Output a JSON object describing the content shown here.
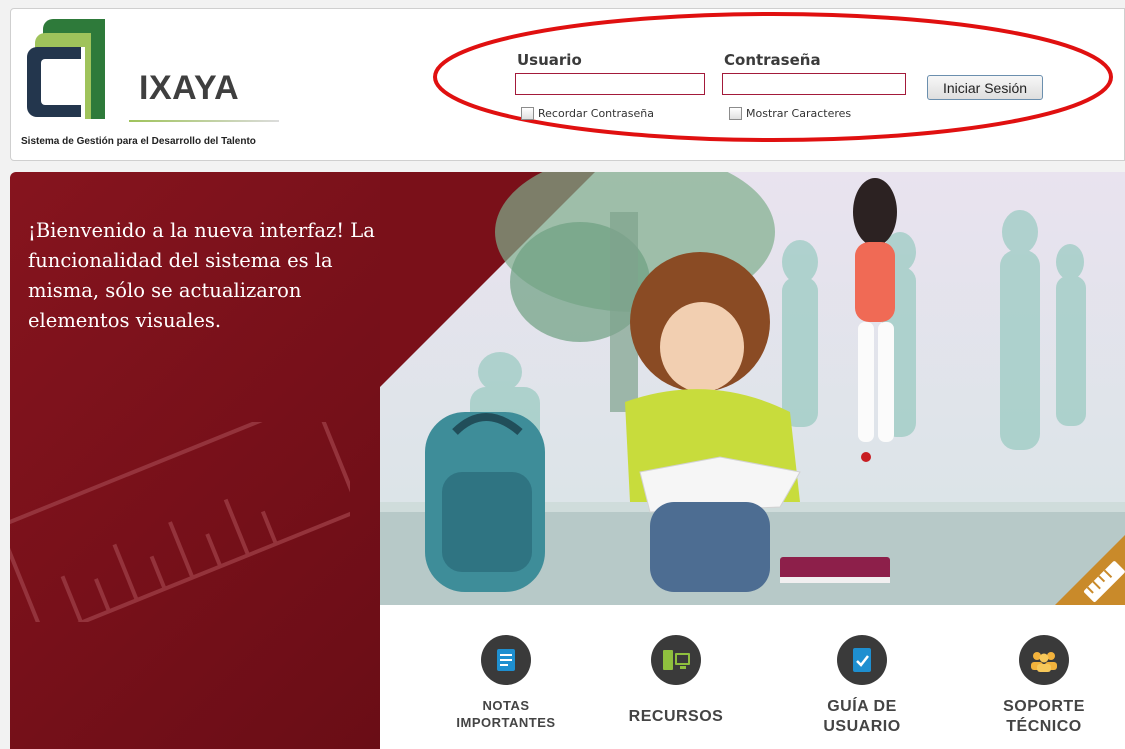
{
  "brand": {
    "name": "IXAYA",
    "tagline": "Sistema de Gestión para el Desarrollo del Talento"
  },
  "login": {
    "user_label": "Usuario",
    "password_label": "Contraseña",
    "user_value": "",
    "password_value": "",
    "submit_label": "Iniciar Sesión",
    "remember_label": "Recordar Contraseña",
    "show_chars_label": "Mostrar Caracteres"
  },
  "hero": {
    "welcome_text": "¡Bienvenido a la nueva interfaz! La funcionalidad del sistema es la misma, sólo se actualizaron elementos visuales."
  },
  "menu": {
    "items": [
      {
        "label": "NOTAS IMPORTANTES",
        "icon": "notes-icon"
      },
      {
        "label": "RECURSOS",
        "icon": "resources-icon"
      },
      {
        "label": "GUÍA DE USUARIO",
        "icon": "user-guide-icon"
      },
      {
        "label": "SOPORTE TÉCNICO",
        "icon": "support-icon"
      }
    ]
  },
  "colors": {
    "brand_dark_green": "#2e7a3a",
    "brand_light_green": "#9fc35b",
    "hero_red": "#7a1019",
    "annotation_red": "#e01010",
    "menu_icon": "#3a3a3a"
  }
}
